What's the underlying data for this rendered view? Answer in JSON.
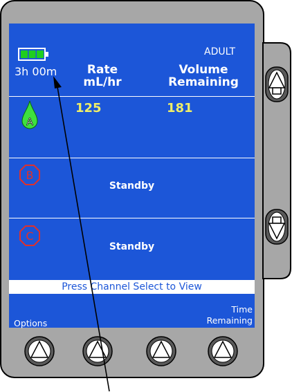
{
  "header": {
    "battery_time": "3h 00m",
    "mode": "ADULT",
    "rate_label": "Rate",
    "rate_unit": "mL/hr",
    "volume_label": "Volume",
    "volume_sub": "Remaining"
  },
  "channels": [
    {
      "letter": "A",
      "rate": "125",
      "volume": "181",
      "status": ""
    },
    {
      "letter": "B",
      "status": "Standby"
    },
    {
      "letter": "C",
      "status": "Standby"
    }
  ],
  "message_bar": "Press Channel Select to View",
  "softkeys": {
    "left": "Options",
    "right_line1": "Time",
    "right_line2": "Remaining"
  },
  "colors": {
    "screen_bg": "#1c56d8",
    "value_yellow": "#f0ee67",
    "channel_a_green": "#3ee03e",
    "channel_bc_red": "#e0302a",
    "battery_green": "#1fce1f",
    "bezel_gray": "#a7a7a7"
  },
  "icons": [
    "battery-icon",
    "drop-icon",
    "octagon-icon",
    "arrow-up-icon",
    "arrow-down-icon",
    "annotation-arrow"
  ]
}
